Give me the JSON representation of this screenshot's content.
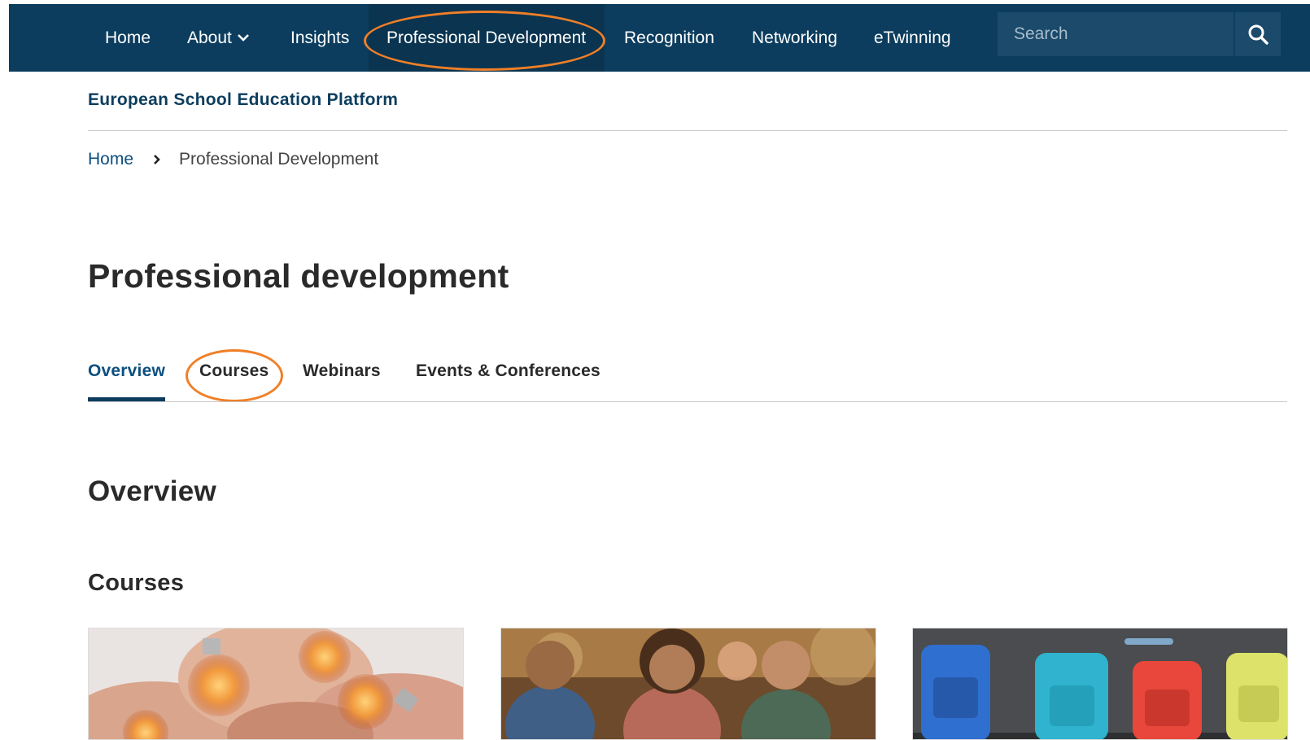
{
  "nav": {
    "items": [
      {
        "label": "Home"
      },
      {
        "label": "About"
      },
      {
        "label": "Insights"
      },
      {
        "label": "Professional Development"
      },
      {
        "label": "Recognition"
      },
      {
        "label": "Networking"
      },
      {
        "label": "eTwinning"
      }
    ],
    "active_index": 3,
    "search_placeholder": "Search"
  },
  "site": {
    "platform_name": "European School Education Platform"
  },
  "breadcrumb": {
    "home": "Home",
    "current": "Professional Development"
  },
  "page": {
    "title": "Professional development"
  },
  "tabs": {
    "items": [
      {
        "label": "Overview"
      },
      {
        "label": "Courses"
      },
      {
        "label": "Webinars"
      },
      {
        "label": "Events & Conferences"
      }
    ],
    "active_index": 0
  },
  "content": {
    "section_title": "Overview",
    "subsection_title": "Courses"
  },
  "cards": [
    {
      "image": "hands-holding-lightbulbs"
    },
    {
      "image": "smiling-children-with-backpacks"
    },
    {
      "image": "colorful-backpacks"
    }
  ],
  "colors": {
    "nav_bg": "#0c3d5e",
    "brand": "#0c3d5e",
    "link": "#0c4f80",
    "highlight": "#f07f27"
  }
}
